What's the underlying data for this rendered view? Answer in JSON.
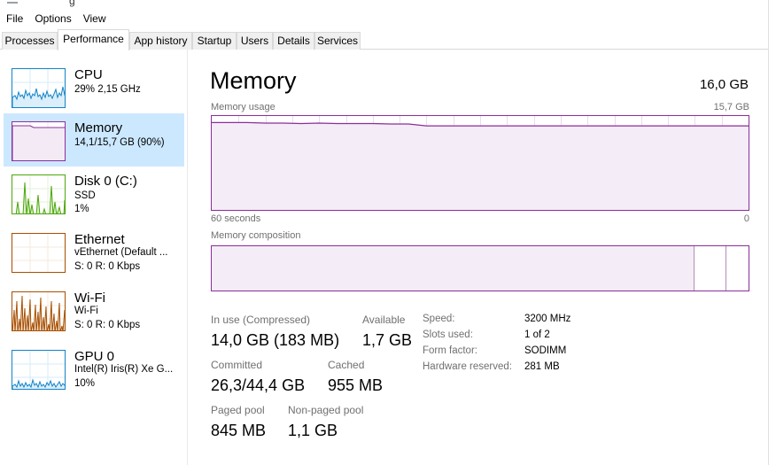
{
  "window": {
    "title_fragment": "g"
  },
  "menu": [
    "File",
    "Options",
    "View"
  ],
  "tabs": [
    "Processes",
    "Performance",
    "App history",
    "Startup",
    "Users",
    "Details",
    "Services"
  ],
  "active_tab": "Performance",
  "sidebar": {
    "items": [
      {
        "title": "CPU",
        "line1": "29% 2,15 GHz",
        "line2": "",
        "icon": "cpu-graph",
        "color": "#1183c6"
      },
      {
        "title": "Memory",
        "line1": "14,1/15,7 GB (90%)",
        "line2": "",
        "icon": "memory-graph",
        "color": "#8b2d9c"
      },
      {
        "title": "Disk 0 (C:)",
        "line1": "SSD",
        "line2": "1%",
        "icon": "disk-graph",
        "color": "#4da60c"
      },
      {
        "title": "Ethernet",
        "line1": "vEthernet (Default ...",
        "line2": "S: 0 R: 0 Kbps",
        "icon": "ethernet-graph",
        "color": "#a74f01"
      },
      {
        "title": "Wi-Fi",
        "line1": "Wi-Fi",
        "line2": "S: 0 R: 0 Kbps",
        "icon": "wifi-graph",
        "color": "#a74f01"
      },
      {
        "title": "GPU 0",
        "line1": "Intel(R) Iris(R) Xe G...",
        "line2": "10%",
        "icon": "gpu-graph",
        "color": "#1183c6"
      }
    ]
  },
  "memory": {
    "title": "Memory",
    "total": "16,0 GB",
    "usage_label": "Memory usage",
    "usage_max": "15,7 GB",
    "time_left": "60 seconds",
    "time_right": "0",
    "composition_label": "Memory composition",
    "composition": {
      "in_use_fraction": 0.9,
      "modified_fraction": 0.06,
      "standby_fraction": 0.04
    },
    "graph_color": "#8b2d9c",
    "stats": {
      "in_use_label": "In use (Compressed)",
      "in_use_value": "14,0 GB (183 MB)",
      "available_label": "Available",
      "available_value": "1,7 GB",
      "committed_label": "Committed",
      "committed_value": "26,3/44,4 GB",
      "cached_label": "Cached",
      "cached_value": "955 MB",
      "paged_pool_label": "Paged pool",
      "paged_pool_value": "845 MB",
      "nonpaged_pool_label": "Non-paged pool",
      "nonpaged_pool_value": "1,1 GB"
    },
    "specs": [
      {
        "label": "Speed:",
        "value": "3200 MHz"
      },
      {
        "label": "Slots used:",
        "value": "1 of 2"
      },
      {
        "label": "Form factor:",
        "value": "SODIMM"
      },
      {
        "label": "Hardware reserved:",
        "value": "281 MB"
      }
    ],
    "usage_series_percent": [
      93,
      93,
      93,
      92.5,
      92.5,
      92,
      92.5,
      92,
      92,
      92,
      91.5,
      91.5,
      89.5,
      89.5,
      89.5,
      89.5,
      89.5,
      89.5,
      89.5,
      89.5,
      89.5,
      89.5,
      89.5,
      89.5,
      89.5,
      89.5,
      89.5,
      89.5,
      89.5,
      89.5,
      89.5
    ]
  }
}
